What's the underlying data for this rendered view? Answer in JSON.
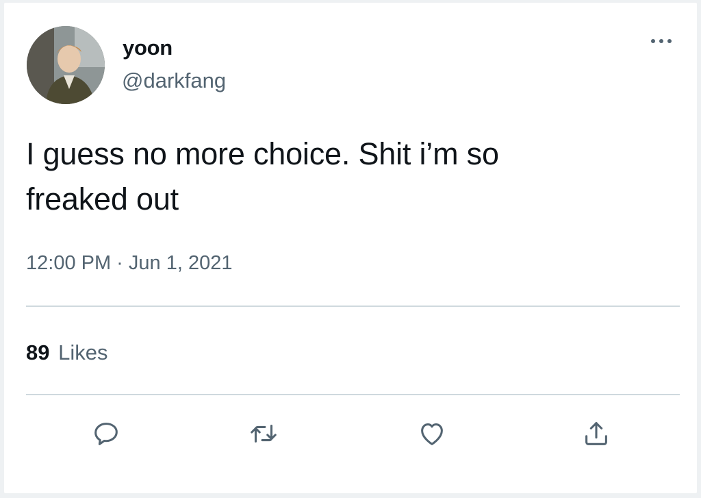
{
  "tweet": {
    "display_name": "yoon",
    "handle": "@darkfang",
    "text_line1": "I guess no more choice. Shit i’m so",
    "text_line2": "freaked out",
    "timestamp": "12:00 PM · Jun 1, 2021",
    "likes_count": "89",
    "likes_label": "Likes"
  },
  "icons": {
    "more": "more-horizontal-icon",
    "reply": "reply-icon",
    "retweet": "retweet-icon",
    "like": "heart-icon",
    "share": "share-icon"
  },
  "colors": {
    "text_primary": "#0f1419",
    "text_secondary": "#536471",
    "divider": "#cfd9de",
    "background": "#ffffff"
  }
}
